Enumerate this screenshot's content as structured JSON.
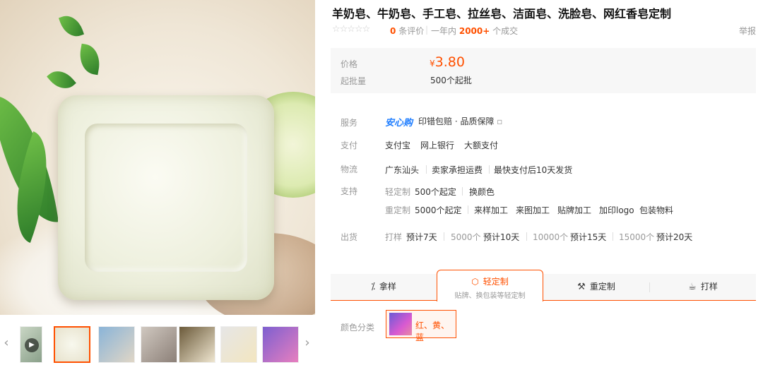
{
  "product": {
    "title": "羊奶皂、牛奶皂、手工皂、拉丝皂、洁面皂、洗脸皂、网红香皂定制",
    "stars_display": "☆☆☆☆☆",
    "review_count": "0",
    "review_suffix": "条评价",
    "sales_prefix": "一年内",
    "sales_count": "2000+",
    "sales_suffix": "个成交",
    "report": "举报"
  },
  "price": {
    "price_label": "价格",
    "currency": "¥",
    "value": "3.80",
    "moq_label": "起批量",
    "moq_value": "500个起批"
  },
  "service": {
    "service_label": "服务",
    "service_brand": "安心购",
    "service_text": "印错包赔 · 品质保障",
    "service_icon": "▫",
    "pay_label": "支付",
    "pay_items": [
      "支付宝",
      "网上银行",
      "大额支付"
    ],
    "logistics_label": "物流",
    "logistics_items": [
      "广东汕头",
      "卖家承担运费",
      "最快支付后10天发货"
    ],
    "support_label": "支持",
    "light_custom_label": "轻定制",
    "light_custom_items": [
      "500个起定",
      "换颜色"
    ],
    "heavy_custom_label": "重定制",
    "heavy_custom_items": [
      "5000个起定",
      "来样加工",
      "来图加工",
      "贴牌加工",
      "加印logo",
      "包装物料"
    ],
    "ship_label": "出货",
    "ship_items": [
      {
        "qty": "打样",
        "time": "预计7天"
      },
      {
        "qty": "5000个",
        "time": "预计10天"
      },
      {
        "qty": "10000个",
        "time": "预计15天"
      },
      {
        "qty": "15000个",
        "time": "预计20天"
      }
    ]
  },
  "tabs": {
    "sample": {
      "label": "拿样",
      "icon": "sample-icon"
    },
    "light": {
      "label": "轻定制",
      "sub": "贴牌、换包装等轻定制",
      "icon": "box-icon"
    },
    "heavy": {
      "label": "重定制",
      "icon": "tools-icon"
    },
    "proof": {
      "label": "打样",
      "icon": "cup-icon"
    }
  },
  "sku": {
    "label": "颜色分类",
    "option": "红、黄、蓝"
  },
  "colors": {
    "accent": "#ff5000",
    "brand_blue": "#1e7dff",
    "muted": "#999999",
    "panel_bg": "#f7f7f7"
  }
}
